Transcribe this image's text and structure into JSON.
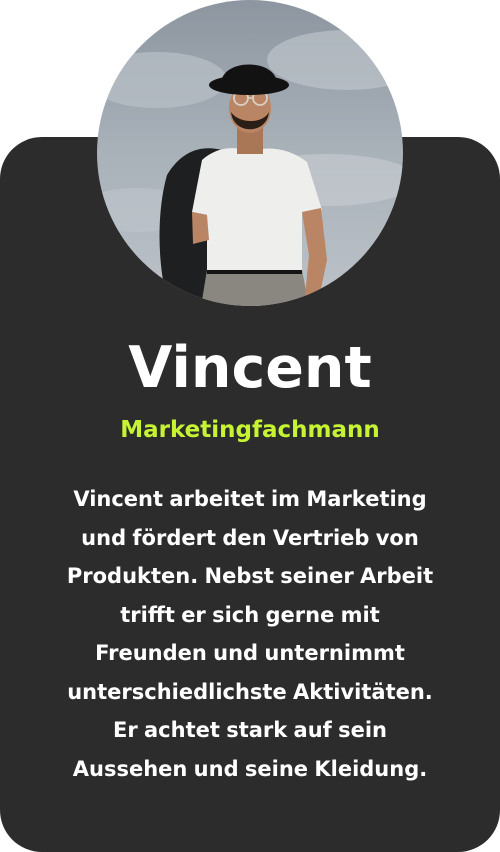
{
  "profile": {
    "name": "Vincent",
    "role": "Marketingfachmann",
    "bio_lines": [
      "Vincent arbeitet im Marketing",
      "und fördert den Vertrieb von",
      "Produkten. Nebst seiner Arbeit",
      "trifft er sich gerne mit",
      "Freunden und unternimmt",
      "unterschiedlichste Aktivitäten.",
      "Er achtet stark auf sein",
      "Aussehen und seine Kleidung."
    ]
  },
  "colors": {
    "card_background": "#2c2c2c",
    "accent": "#c6f432",
    "text": "#ffffff",
    "page_background": "#ffffff"
  }
}
